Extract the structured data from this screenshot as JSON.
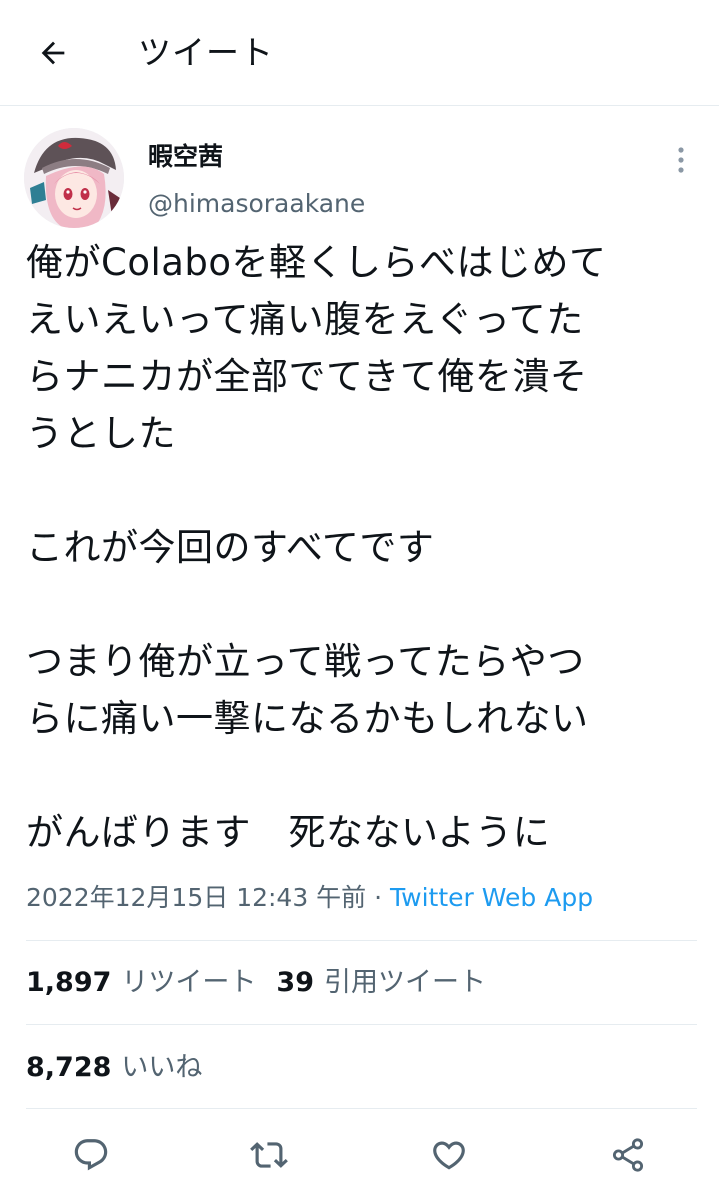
{
  "header": {
    "title": "ツイート",
    "back_icon": "arrow-left-icon"
  },
  "author": {
    "name": "暇空茜",
    "handle": "@himasoraakane",
    "avatar_icon": "avatar-image"
  },
  "tweet": {
    "text": "俺がColaboを軽くしらべはじめて\nえいえいって痛い腹をえぐってた\nらナニカが全部でてきて俺を潰そ\nうとした\n\nこれが今回のすべてです\n\nつまり俺が立って戦ってたらやつ\nらに痛い一撃になるかもしれない\n\nがんばります　死なないように",
    "timestamp": "2022年12月15日 12:43 午前",
    "separator": " · ",
    "source": "Twitter Web App"
  },
  "stats": {
    "retweets": "1,897",
    "retweets_label": "リツイート",
    "quotes": "39",
    "quotes_label": "引用ツイート",
    "likes": "8,728",
    "likes_label": "いいね"
  },
  "colors": {
    "accent": "#1d9bf0",
    "text": "#0f1419",
    "secondary": "#536471",
    "divider": "#e6ecf0"
  },
  "actions": [
    "reply-icon",
    "retweet-icon",
    "like-icon",
    "share-icon"
  ]
}
